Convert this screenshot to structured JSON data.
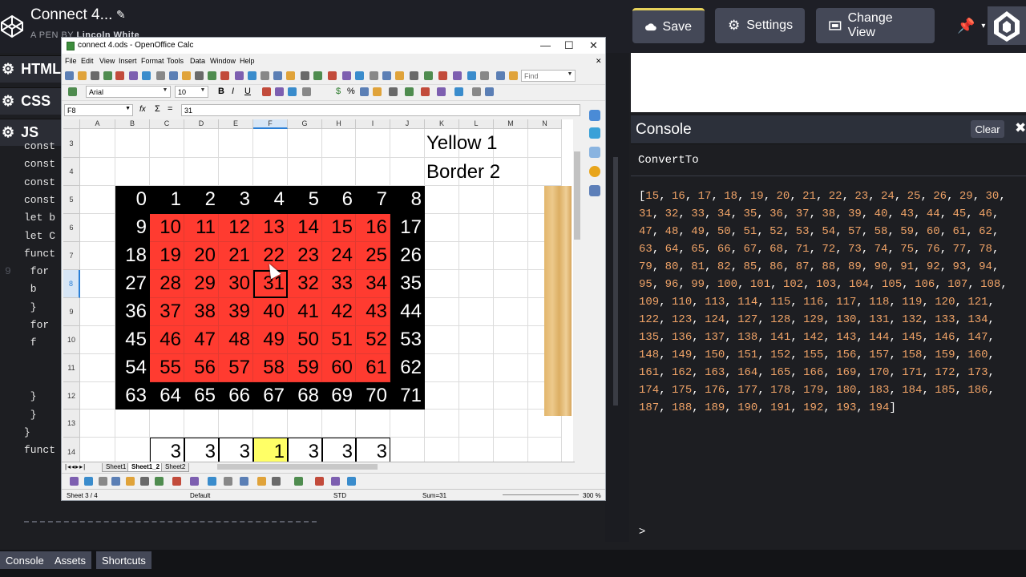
{
  "header": {
    "pen_title": "Connect 4...",
    "by_prefix": "A PEN BY",
    "author": "Lincoln White",
    "save_label": "Save",
    "settings_label": "Settings",
    "change_view_label": "Change View"
  },
  "editor": {
    "html_label": "HTML",
    "css_label": "CSS",
    "js_label": "JS",
    "code_lines": [
      {
        "ln": "",
        "text": "const"
      },
      {
        "ln": "",
        "text": "const"
      },
      {
        "ln": "",
        "text": "const"
      },
      {
        "ln": "",
        "text": "const"
      },
      {
        "ln": "",
        "text": "let b"
      },
      {
        "ln": "",
        "text": "let C"
      },
      {
        "ln": "",
        "text": "funct"
      },
      {
        "ln": "9",
        "text": "  for"
      },
      {
        "ln": "",
        "text": "    b"
      },
      {
        "ln": "",
        "text": "  }"
      },
      {
        "ln": "",
        "text": "  for"
      },
      {
        "ln": "",
        "text": "    f"
      },
      {
        "ln": "",
        "text": ""
      },
      {
        "ln": "",
        "text": ""
      },
      {
        "ln": "",
        "text": "    }"
      },
      {
        "ln": "",
        "text": "  }"
      },
      {
        "ln": "",
        "text": "}"
      },
      {
        "ln": "",
        "text": "funct"
      }
    ]
  },
  "calc": {
    "window_title": "connect 4.ods - OpenOffice Calc",
    "menus": [
      "File",
      "Edit",
      "View",
      "Insert",
      "Format",
      "Tools",
      "Data",
      "Window",
      "Help"
    ],
    "find_placeholder": "Find",
    "font_name": "Arial",
    "font_size": "10",
    "cell_ref": "F8",
    "formula_value": "31",
    "columns": [
      "A",
      "B",
      "C",
      "D",
      "E",
      "F",
      "G",
      "H",
      "I",
      "J",
      "K",
      "L",
      "M",
      "N"
    ],
    "selected_column": "F",
    "rows": [
      "3",
      "4",
      "5",
      "6",
      "7",
      "8",
      "9",
      "10",
      "11",
      "12",
      "13",
      "14"
    ],
    "selected_row": "8",
    "label_yellow": "Yellow 1",
    "label_border": "Border 2",
    "board": [
      [
        "0",
        "1",
        "2",
        "3",
        "4",
        "5",
        "6",
        "7",
        "8"
      ],
      [
        "9",
        "10",
        "11",
        "12",
        "13",
        "14",
        "15",
        "16",
        "17"
      ],
      [
        "18",
        "19",
        "20",
        "21",
        "22",
        "23",
        "24",
        "25",
        "26"
      ],
      [
        "27",
        "28",
        "29",
        "30",
        "31",
        "32",
        "33",
        "34",
        "35"
      ],
      [
        "36",
        "37",
        "38",
        "39",
        "40",
        "41",
        "42",
        "43",
        "44"
      ],
      [
        "45",
        "46",
        "47",
        "48",
        "49",
        "50",
        "51",
        "52",
        "53"
      ],
      [
        "54",
        "55",
        "56",
        "57",
        "58",
        "59",
        "60",
        "61",
        "62"
      ],
      [
        "63",
        "64",
        "65",
        "66",
        "67",
        "68",
        "69",
        "70",
        "71"
      ]
    ],
    "bottom_row": [
      "3",
      "3",
      "3",
      "1",
      "3",
      "3",
      "3"
    ],
    "sheet_tabs": [
      "Sheet1",
      "Sheet1_2",
      "Sheet2"
    ],
    "active_sheet": "Sheet1_2",
    "status": {
      "sheet": "Sheet 3 / 4",
      "style": "Default",
      "mode": "STD",
      "sum": "Sum=31",
      "zoom": "300 %"
    }
  },
  "console": {
    "title": "Console",
    "clear_label": "Clear",
    "log_label": "ConvertTo",
    "array_values": [
      15,
      16,
      17,
      18,
      19,
      20,
      21,
      22,
      23,
      24,
      25,
      26,
      29,
      30,
      31,
      32,
      33,
      34,
      35,
      36,
      37,
      38,
      39,
      40,
      43,
      44,
      45,
      46,
      47,
      48,
      49,
      50,
      51,
      52,
      53,
      54,
      57,
      58,
      59,
      60,
      61,
      62,
      63,
      64,
      65,
      66,
      67,
      68,
      71,
      72,
      73,
      74,
      75,
      76,
      77,
      78,
      79,
      80,
      81,
      82,
      85,
      86,
      87,
      88,
      89,
      90,
      91,
      92,
      93,
      94,
      95,
      96,
      99,
      100,
      101,
      102,
      103,
      104,
      105,
      106,
      107,
      108,
      109,
      110,
      113,
      114,
      115,
      116,
      117,
      118,
      119,
      120,
      121,
      122,
      123,
      124,
      127,
      128,
      129,
      130,
      131,
      132,
      133,
      134,
      135,
      136,
      137,
      138,
      141,
      142,
      143,
      144,
      145,
      146,
      147,
      148,
      149,
      150,
      151,
      152,
      155,
      156,
      157,
      158,
      159,
      160,
      161,
      162,
      163,
      164,
      165,
      166,
      169,
      170,
      171,
      172,
      173,
      174,
      175,
      176,
      177,
      178,
      179,
      180,
      183,
      184,
      185,
      186,
      187,
      188,
      189,
      190,
      191,
      192,
      193,
      194
    ],
    "prompt": ">"
  },
  "bottombar": {
    "console_label": "Console",
    "assets_label": "Assets",
    "shortcuts_label": "Shortcuts"
  },
  "colors": {
    "black_cell": "#000000",
    "red_cell": "#ff3b30",
    "yellow_cell": "#ffff66",
    "number_color": "#f0a367"
  },
  "icons": [
    "codepen-logo-icon",
    "pencil-icon",
    "cloud-icon",
    "gear-icon",
    "change-view-icon",
    "pin-icon",
    "close-icon"
  ]
}
